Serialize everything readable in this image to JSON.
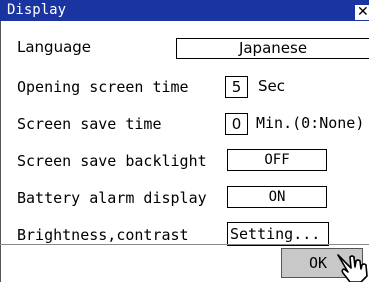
{
  "window": {
    "title": "Display",
    "close_glyph": "✕"
  },
  "settings": {
    "language": {
      "label": "Language",
      "value": "Japanese"
    },
    "opening_screen_time": {
      "label": "Opening screen time",
      "value": "5",
      "unit": "Sec"
    },
    "screen_save_time": {
      "label": "Screen save time",
      "value": "0",
      "unit": "Min.(0:None)"
    },
    "screen_save_backlight": {
      "label": "Screen save backlight",
      "value": "OFF"
    },
    "battery_alarm_display": {
      "label": "Battery alarm display",
      "value": "ON"
    },
    "brightness_contrast": {
      "label": "Brightness,contrast",
      "button": "Setting..."
    }
  },
  "footer": {
    "ok_label": "OK"
  },
  "icons": {
    "cursor": "hand-pointer-icon",
    "close": "close-icon"
  }
}
